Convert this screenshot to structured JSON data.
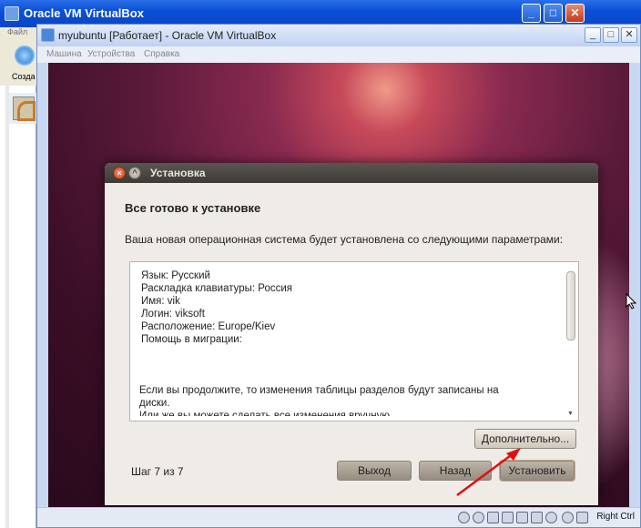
{
  "outer_window": {
    "title": "Oracle VM VirtualBox",
    "menu_file": "Файл",
    "toolbar_create_label": "Созда",
    "controls": {
      "minimize": "_",
      "maximize": "□",
      "close": "✕"
    }
  },
  "vm_window": {
    "title": "myubuntu [Работает] - Oracle VM VirtualBox",
    "menu": [
      "Машина",
      "Устройства",
      "Справка"
    ],
    "controls": {
      "minimize": "_",
      "maximize": "□",
      "close": "✕"
    },
    "host_key": "Right Ctrl"
  },
  "installer": {
    "window_title": "Установка",
    "heading": "Все готово к установке",
    "description": "Ваша новая операционная система будет установлена со следующими параметрами:",
    "summary_lines": [
      "Язык: Русский",
      "Раскладка клавиатуры: Россия",
      "Имя: vik",
      "Логин: viksoft",
      "Расположение: Europe/Kiev",
      "Помощь в миграции:"
    ],
    "summary_footer": [
      "Если вы продолжите, то изменения таблицы разделов будут записаны на",
      "диски.",
      "Или же вы можете сделать все изменения вручную."
    ],
    "advanced_button": "Дополнительно...",
    "step_text": "Шаг 7 из 7",
    "quit_button": "Выход",
    "back_button": "Назад",
    "install_button": "Установить"
  }
}
